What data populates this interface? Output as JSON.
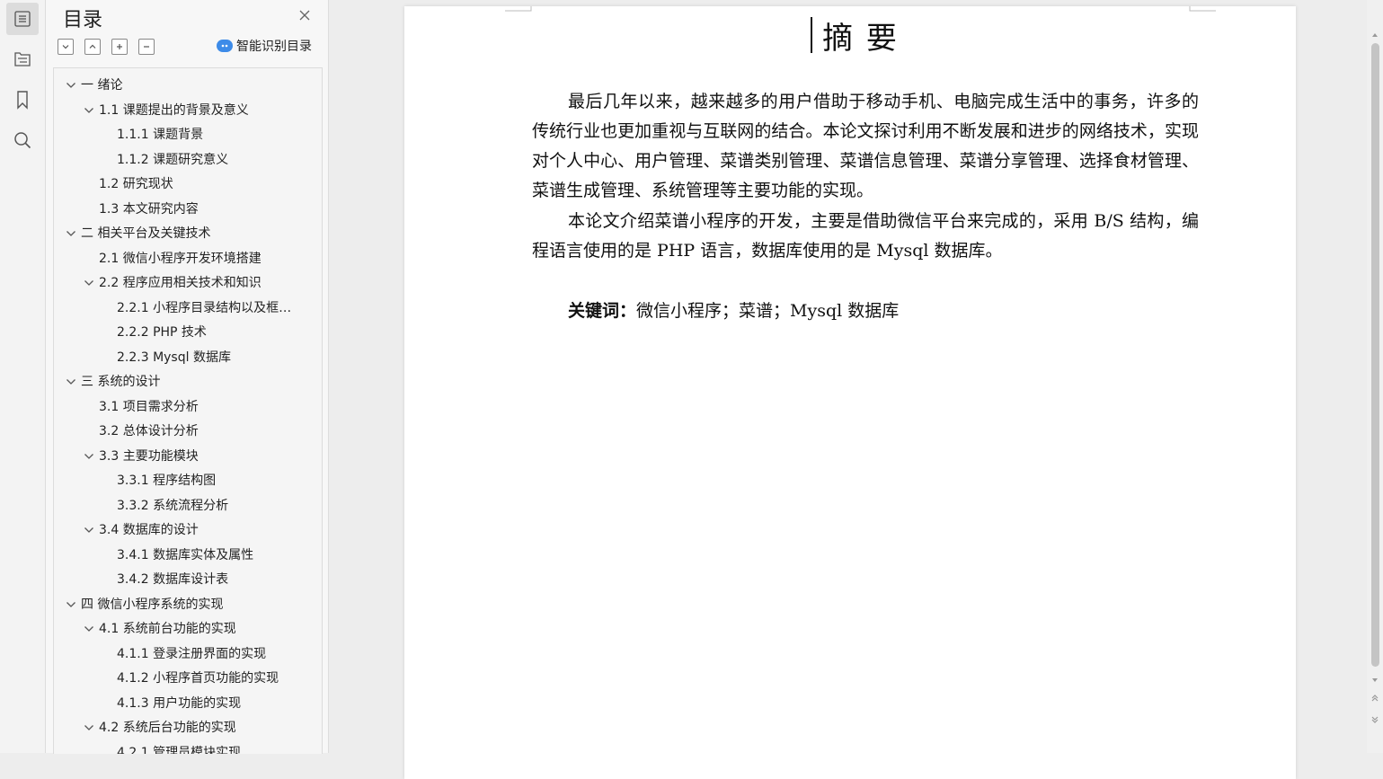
{
  "sidebar": {
    "title": "目录",
    "ai_label": "智能识别目录",
    "toc": [
      {
        "label": "一  绪论",
        "level": 1,
        "expanded": true
      },
      {
        "label": "1.1 课题提出的背景及意义",
        "level": 2,
        "expanded": true
      },
      {
        "label": "1.1.1 课题背景",
        "level": 3
      },
      {
        "label": "1.1.2 课题研究意义",
        "level": 3
      },
      {
        "label": "1.2 研究现状",
        "level": 2
      },
      {
        "label": "1.3 本文研究内容",
        "level": 2
      },
      {
        "label": "二  相关平台及关键技术",
        "level": 1,
        "expanded": true
      },
      {
        "label": "2.1 微信小程序开发环境搭建",
        "level": 2
      },
      {
        "label": "2.2 程序应用相关技术和知识",
        "level": 2,
        "expanded": true
      },
      {
        "label": "2.2.1 小程序目录结构以及框…",
        "level": 3
      },
      {
        "label": "2.2.2 PHP 技术",
        "level": 3
      },
      {
        "label": "2.2.3 Mysql 数据库",
        "level": 3
      },
      {
        "label": "三  系统的设计",
        "level": 1,
        "expanded": true
      },
      {
        "label": "3.1 项目需求分析",
        "level": 2
      },
      {
        "label": "3.2 总体设计分析",
        "level": 2
      },
      {
        "label": "3.3 主要功能模块",
        "level": 2,
        "expanded": true
      },
      {
        "label": "3.3.1 程序结构图",
        "level": 3
      },
      {
        "label": "3.3.2 系统流程分析",
        "level": 3
      },
      {
        "label": "3.4 数据库的设计",
        "level": 2,
        "expanded": true
      },
      {
        "label": "3.4.1 数据库实体及属性",
        "level": 3
      },
      {
        "label": "3.4.2 数据库设计表",
        "level": 3
      },
      {
        "label": "四  微信小程序系统的实现",
        "level": 1,
        "expanded": true
      },
      {
        "label": "4.1 系统前台功能的实现",
        "level": 2,
        "expanded": true
      },
      {
        "label": "4.1.1 登录注册界面的实现",
        "level": 3
      },
      {
        "label": "4.1.2 小程序首页功能的实现",
        "level": 3
      },
      {
        "label": "4.1.3 用户功能的实现",
        "level": 3
      },
      {
        "label": "4.2 系统后台功能的实现",
        "level": 2,
        "expanded": true
      },
      {
        "label": "4.2.1 管理员模块实现",
        "level": 3
      }
    ]
  },
  "document": {
    "title": "摘  要",
    "paragraph1": "最后几年以来，越来越多的用户借助于移动手机、电脑完成生活中的事务，许多的传统行业也更加重视与互联网的结合。本论文探讨利用不断发展和进步的网络技术，实现对个人中心、用户管理、菜谱类别管理、菜谱信息管理、菜谱分享管理、选择食材管理、菜谱生成管理、系统管理等主要功能的实现。",
    "paragraph2": "本论文介绍菜谱小程序的开发，主要是借助微信平台来完成的，采用 B/S 结构，编程语言使用的是 PHP 语言，数据库使用的是 Mysql 数据库。",
    "keywords_label": "关键词：",
    "keywords_value": "微信小程序；菜谱；Mysql 数据库"
  }
}
